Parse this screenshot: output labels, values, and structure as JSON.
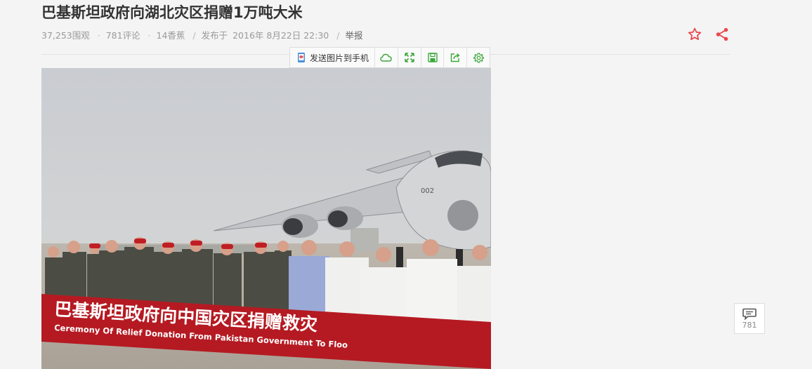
{
  "article": {
    "title": "巴基斯坦政府向湖北灾区捐赠1万吨大米",
    "meta": {
      "views": "37,253围观",
      "comments": "781评论",
      "bananas": "14香蕉",
      "published_label": "发布于",
      "published_date": "2016年 8月22日 22:30",
      "report": "举报"
    }
  },
  "icons": {
    "favorite": "star-outline-icon",
    "share": "share-icon",
    "send_to_phone": "phone-send-icon",
    "cloud": "cloud-icon",
    "fullscreen": "expand-icon",
    "save": "save-icon",
    "open_external": "external-share-icon",
    "settings": "gear-icon",
    "comment": "comment-bubble-icon"
  },
  "image_toolbar": {
    "send_label": "发送图片到手机"
  },
  "photo": {
    "banner_chinese": "巴基斯坦政府向中国灾区捐赠救灾",
    "banner_english": "Ceremony Of Relief Donation From Pakistan Government To Floo",
    "aircraft_number": "002"
  },
  "comment_float": {
    "count": "781"
  },
  "colors": {
    "accent_red": "#e8474d",
    "toolbar_green": "#3aa83a",
    "banner_red": "#b51a22",
    "background": "#f4f4f4"
  }
}
